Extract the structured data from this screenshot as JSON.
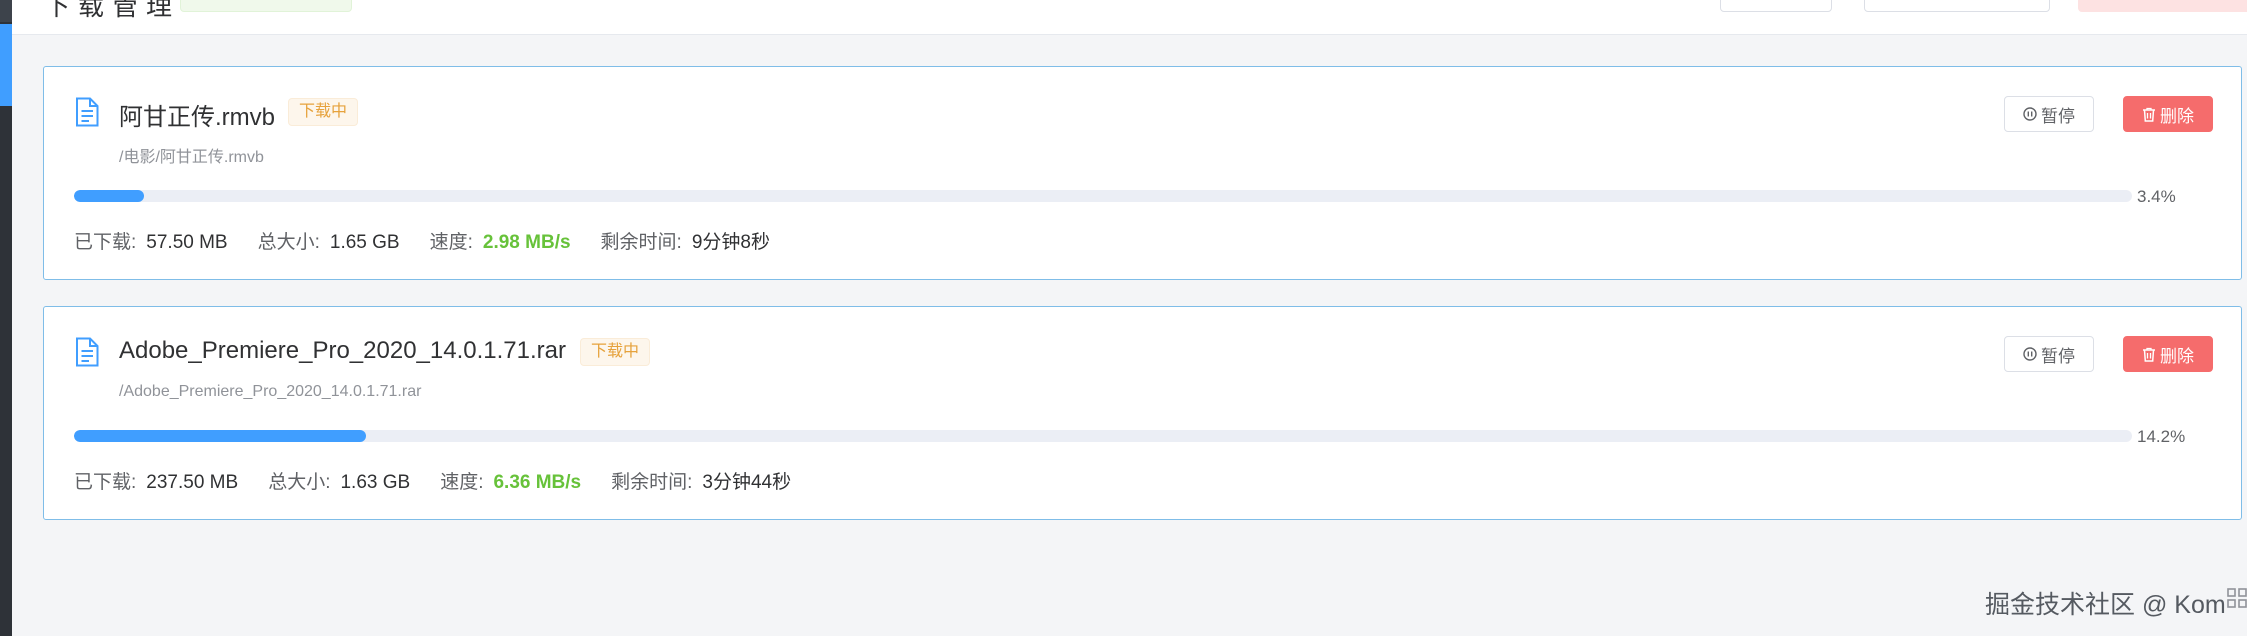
{
  "header": {
    "title_fragment": "下载管理"
  },
  "downloads": [
    {
      "name": "阿甘正传.rmvb",
      "status": "下载中",
      "path": "/电影/阿甘正传.rmvb",
      "progress_percent": 3.4,
      "progress_label": "3.4%",
      "downloaded_label": "已下载:",
      "downloaded": "57.50 MB",
      "total_label": "总大小:",
      "total": "1.65 GB",
      "speed_label": "速度:",
      "speed": "2.98 MB/s",
      "remaining_label": "剩余时间:",
      "remaining": "9分钟8秒",
      "pause_label": "暂停",
      "delete_label": "删除"
    },
    {
      "name": "Adobe_Premiere_Pro_2020_14.0.1.71.rar",
      "status": "下载中",
      "path": "/Adobe_Premiere_Pro_2020_14.0.1.71.rar",
      "progress_percent": 14.2,
      "progress_label": "14.2%",
      "downloaded_label": "已下载:",
      "downloaded": "237.50 MB",
      "total_label": "总大小:",
      "total": "1.63 GB",
      "speed_label": "速度:",
      "speed": "6.36 MB/s",
      "remaining_label": "剩余时间:",
      "remaining": "3分钟44秒",
      "pause_label": "暂停",
      "delete_label": "删除"
    }
  ],
  "icons": {
    "file": "file-document-icon",
    "pause": "pause-circle-icon",
    "delete": "trash-icon",
    "corner": "grid-icon"
  },
  "colors": {
    "accent": "#409eff",
    "status_warning": "#e6a23c",
    "speed": "#67c23a",
    "danger": "#f56c6c",
    "card_border": "#7fbde8"
  },
  "watermark": "掘金技术社区 @ Kom"
}
